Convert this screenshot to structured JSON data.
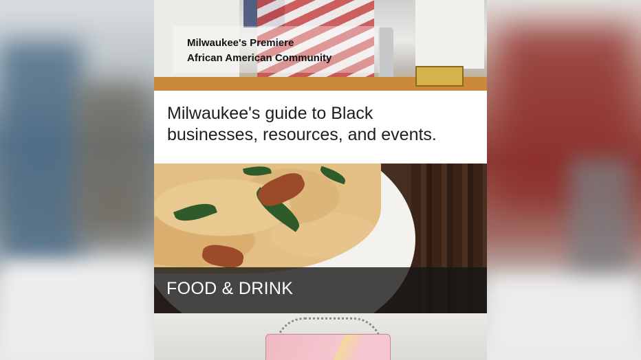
{
  "hero": {
    "label_line1": "Milwaukee's Premiere",
    "label_line2": "African American Community"
  },
  "tagline": {
    "line1": "Milwaukee's guide to Black",
    "line2": "businesses, resources, and events."
  },
  "categories": [
    {
      "label": "FOOD & DRINK"
    }
  ],
  "colors": {
    "banner_overlay": "#141414",
    "text_dark": "#1e1e1e",
    "text_light": "#ffffff"
  }
}
